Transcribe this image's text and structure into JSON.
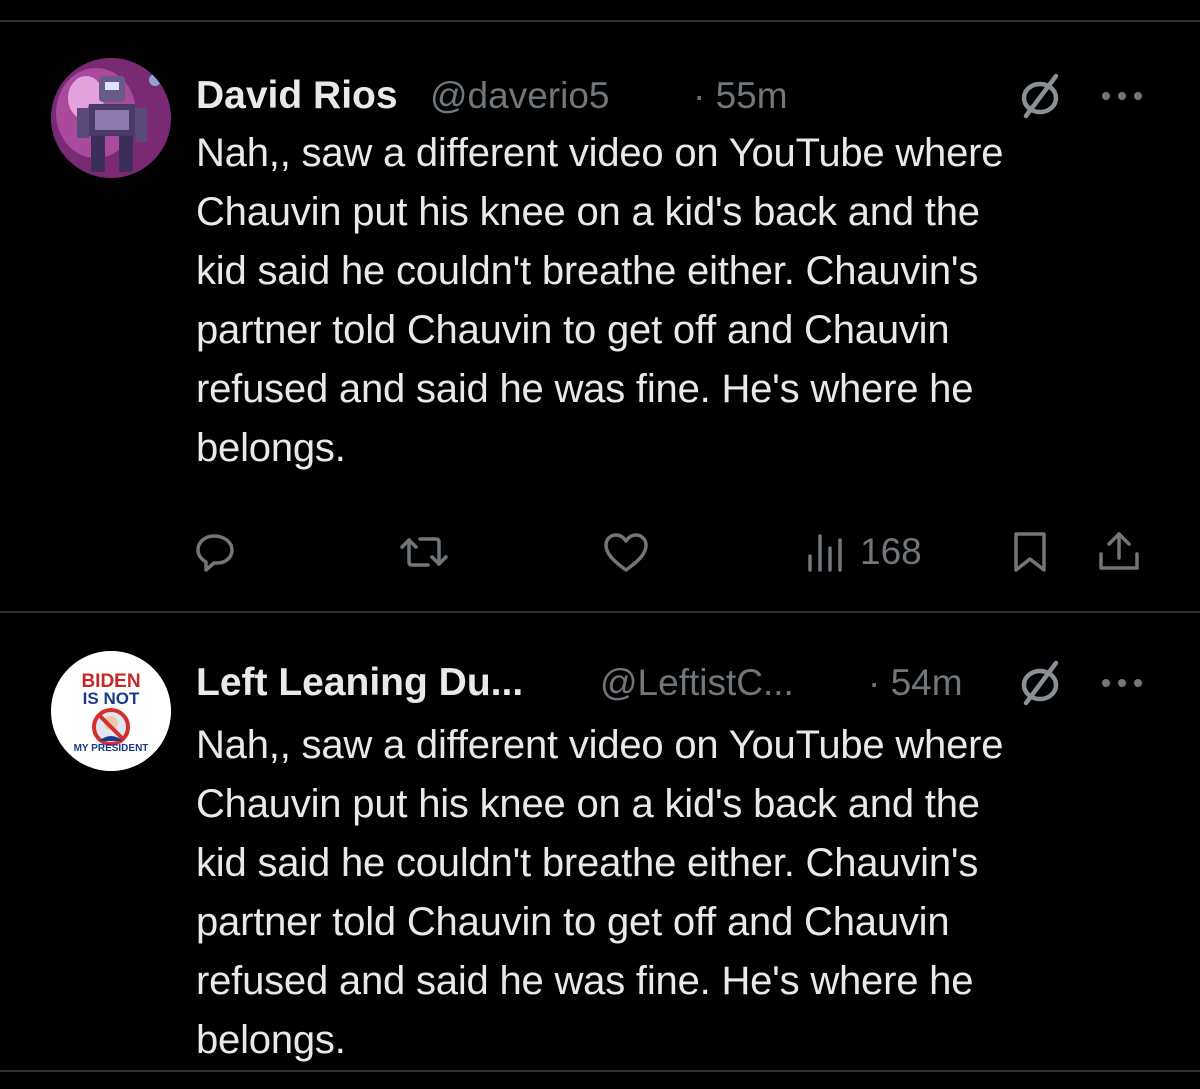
{
  "tweets": [
    {
      "author_name": "David Rios",
      "handle": "@daverio5",
      "time": "· 55m",
      "text": "Nah,, saw a different video on YouTube where\nChauvin put his knee on a kid's back and the\nkid said he couldn't breathe either. Chauvin's\npartner told Chauvin to get off and Chauvin\nrefused and said he was fine. He's where he\nbelongs.",
      "views": "168",
      "avatar_icon": "robot-avatar"
    },
    {
      "author_name": "Left Leaning Du...",
      "handle": "@LeftistC...",
      "time": "· 54m",
      "text": "Nah,, saw a different video on YouTube where\nChauvin put his knee on a kid's back and the\nkid said he couldn't breathe either. Chauvin's\npartner told Chauvin to get off and Chauvin\nrefused and said he was fine. He's where he\nbelongs.",
      "avatar_text_top": "BIDEN",
      "avatar_text_mid": "IS NOT",
      "avatar_text_bottom": "MY PRESIDENT"
    }
  ],
  "colors": {
    "background": "#000000",
    "text": "#e7e9ea",
    "muted": "#71767b",
    "divider": "#2f3336"
  }
}
